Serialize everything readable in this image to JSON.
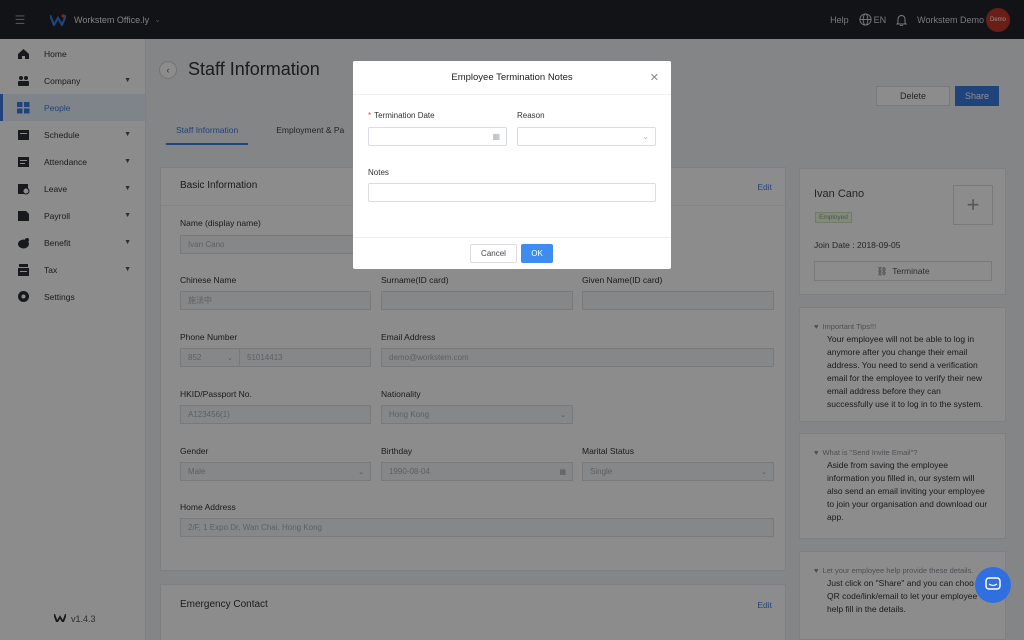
{
  "topbar": {
    "org_name": "Workstem Office.ly",
    "help": "Help",
    "language": "EN",
    "user_name": "Workstem Demo",
    "avatar_text": "Demo"
  },
  "sidebar": {
    "items": [
      {
        "label": "Home",
        "icon": "home-icon"
      },
      {
        "label": "Company",
        "icon": "company-icon"
      },
      {
        "label": "People",
        "icon": "people-icon"
      },
      {
        "label": "Schedule",
        "icon": "schedule-icon"
      },
      {
        "label": "Attendance",
        "icon": "attendance-icon"
      },
      {
        "label": "Leave",
        "icon": "leave-icon"
      },
      {
        "label": "Payroll",
        "icon": "payroll-icon"
      },
      {
        "label": "Benefit",
        "icon": "benefit-icon"
      },
      {
        "label": "Tax",
        "icon": "tax-icon"
      },
      {
        "label": "Settings",
        "icon": "settings-icon"
      }
    ],
    "version": "v1.4.3"
  },
  "page": {
    "title": "Staff Information",
    "delete_label": "Delete",
    "share_label": "Share",
    "tabs": [
      "Staff Information",
      "Employment & Pa"
    ]
  },
  "basic_info": {
    "title": "Basic Information",
    "edit": "Edit",
    "fields": {
      "display_name_label": "Name (display name)",
      "display_name_value": "Ivan Cano",
      "chinese_name_label": "Chinese Name",
      "chinese_name_value": "施法中",
      "surname_label": "Surname(ID card)",
      "given_name_label": "Given Name(ID card)",
      "phone_label": "Phone Number",
      "phone_code": "852",
      "phone_value": "51014413",
      "email_label": "Email Address",
      "email_value": "demo@workstem.com",
      "hkid_label": "HKID/Passport No.",
      "hkid_value": "A123456(1)",
      "nationality_label": "Nationality",
      "nationality_value": "Hong Kong",
      "gender_label": "Gender",
      "gender_value": "Male",
      "birthday_label": "Birthday",
      "birthday_value": "1990-08-04",
      "marital_label": "Marital Status",
      "marital_value": "Single",
      "address_label": "Home Address",
      "address_value": "2/F, 1 Expo Dr, Wan Chai, Hong Kong"
    }
  },
  "emergency": {
    "title": "Emergency Contact",
    "edit": "Edit"
  },
  "profile": {
    "name": "Ivan Cano",
    "status": "Employed",
    "join_date": "Join Date : 2018-09-05",
    "terminate": "Terminate"
  },
  "tips": [
    {
      "head": "Important Tips!!!",
      "body": "Your employee will not be able to log in anymore after you change their email address. You need to send a verification email for the employee to verify their new email address before they can successfully use it to log in to the system."
    },
    {
      "head": "What is \"Send Invite Email\"?",
      "body": "Aside from saving the employee information you filled in, our system will also send an email inviting your employee to join your organisation and download our app."
    },
    {
      "head": "Let your employee help provide these details.",
      "body": "Just click on \"Share\" and you can choo the QR code/link/email to let your employee help fill in the details."
    }
  ],
  "modal": {
    "title": "Employee Termination Notes",
    "termination_date_label": "Termination Date",
    "reason_label": "Reason",
    "notes_label": "Notes",
    "cancel": "Cancel",
    "ok": "OK"
  },
  "colors": {
    "accent": "#3d7be0",
    "topbar": "#1f2329",
    "avatar": "#c0392b"
  }
}
